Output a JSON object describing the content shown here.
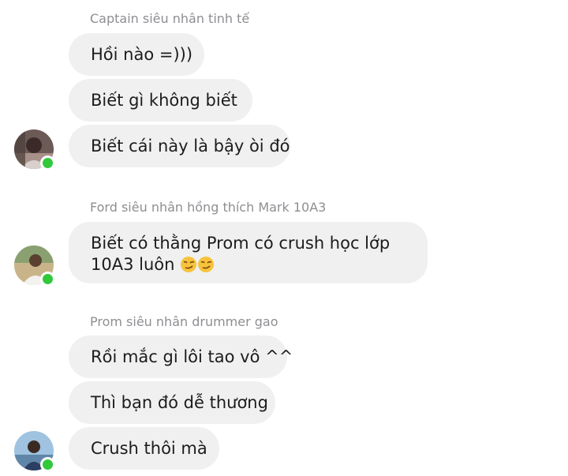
{
  "groups": [
    {
      "sender": "Captain siêu nhân tinh tế",
      "messages": [
        "Hồi nào =)))",
        "Biết gì không biết",
        "Biết cái này là bậy òi đó"
      ]
    },
    {
      "sender": "Ford siêu nhân hồng thích Mark 10A3",
      "messages": [
        "Biết có thằng Prom có crush học lớp 10A3 luôn"
      ],
      "emoji": "smirking-face-icon"
    },
    {
      "sender": "Prom siêu nhân drummer gao",
      "messages": [
        "Rồi mắc gì lôi tao vô ^^",
        "Thì bạn đó dễ thương",
        "Crush thôi mà"
      ]
    }
  ],
  "colors": {
    "bubble": "#f0f0f0",
    "sender_text": "#8e8e93",
    "online_dot": "#31c83a"
  }
}
